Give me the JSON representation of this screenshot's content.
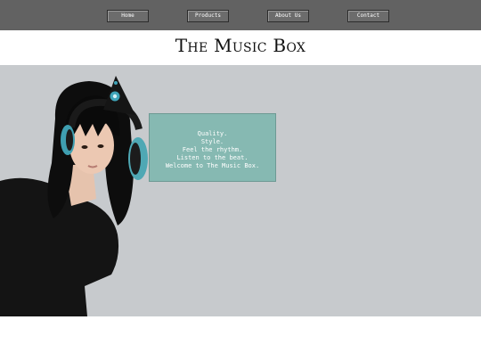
{
  "nav": {
    "items": [
      {
        "label": "Home"
      },
      {
        "label": "Products"
      },
      {
        "label": "About Us"
      },
      {
        "label": "Contact"
      }
    ]
  },
  "header": {
    "title": "The Music Box"
  },
  "hero": {
    "lines": [
      "Quality.",
      "Style.",
      "Feel the rhythm.",
      "Listen to the beat.",
      "Welcome to The Music Box."
    ]
  },
  "colors": {
    "nav_bg": "#626262",
    "hero_bg": "#c7cacd",
    "caption_bg": "#86b9b2",
    "headphone_accent": "#4fa8b4"
  }
}
